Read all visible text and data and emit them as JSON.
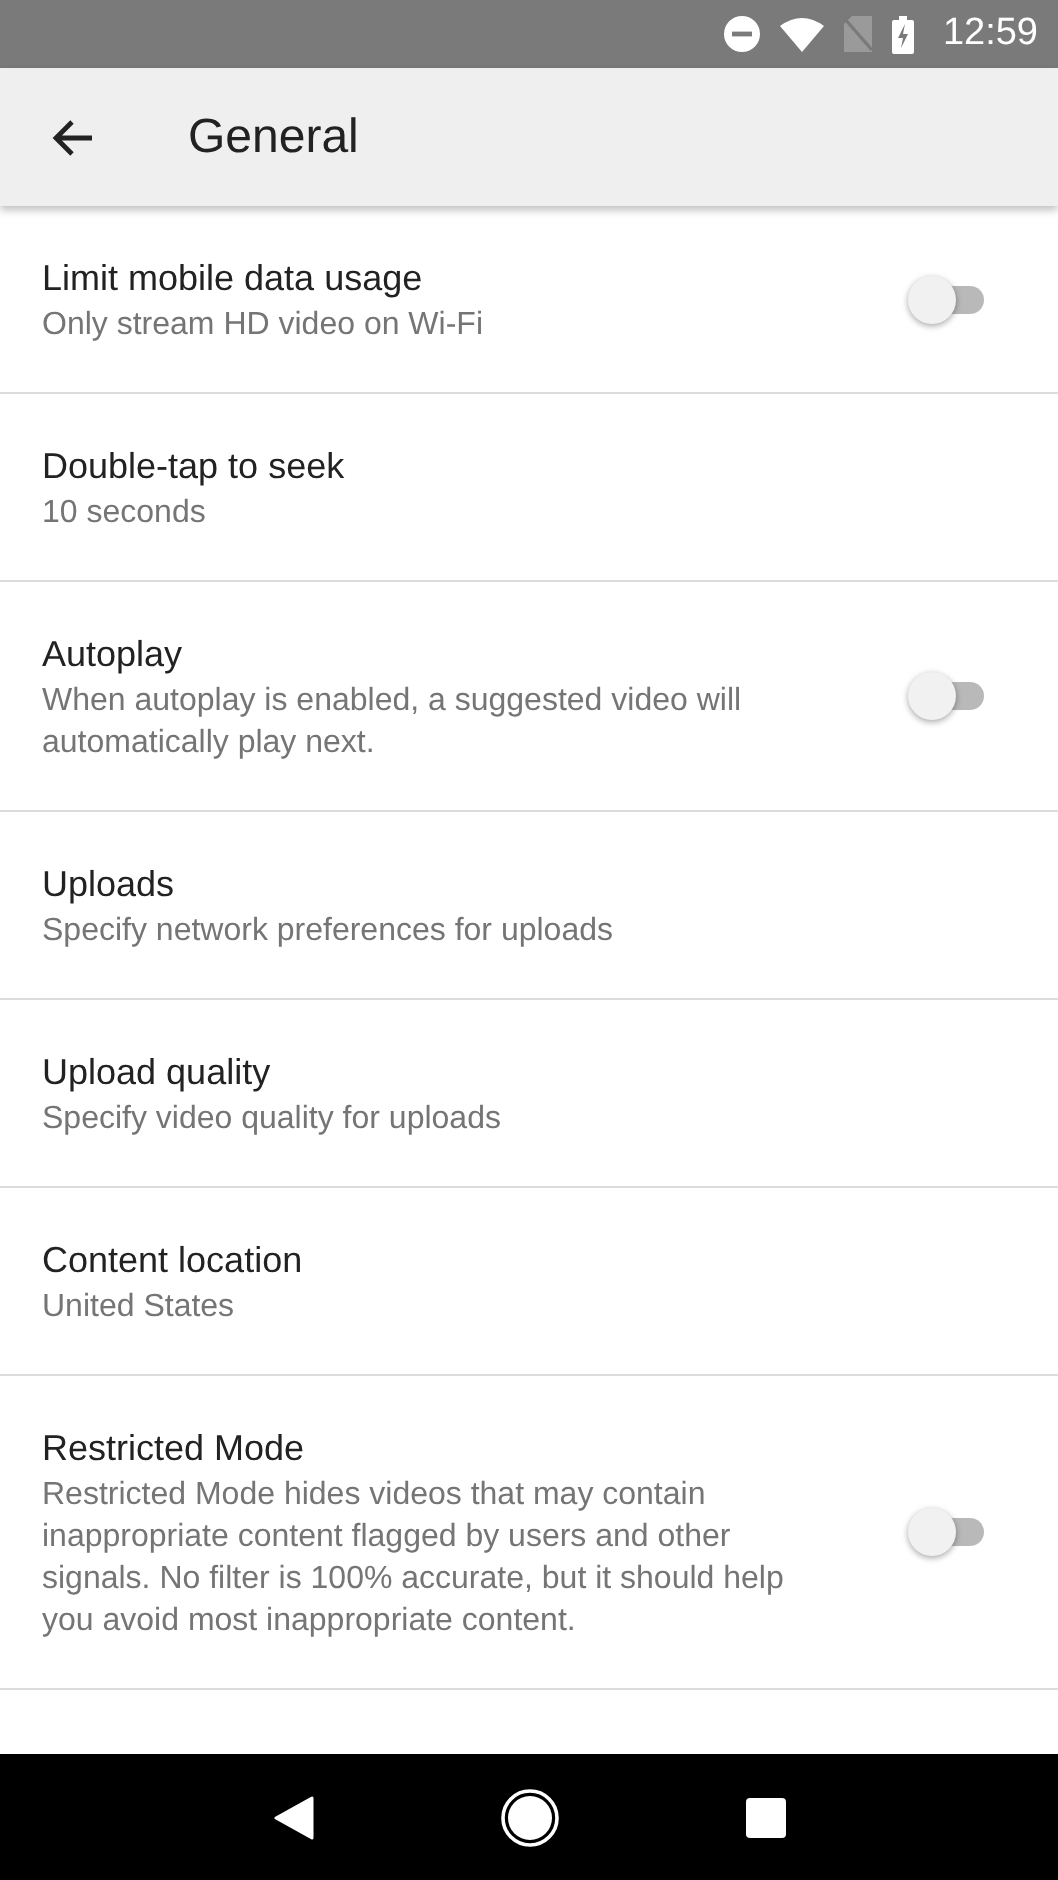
{
  "status_bar": {
    "time": "12:59"
  },
  "app_bar": {
    "title": "General"
  },
  "settings": [
    {
      "kind": "toggle",
      "title": "Limit mobile data usage",
      "subtitle": "Only stream HD video on Wi-Fi",
      "on": false
    },
    {
      "kind": "plain",
      "title": "Double-tap to seek",
      "subtitle": "10 seconds"
    },
    {
      "kind": "toggle",
      "title": "Autoplay",
      "subtitle": "When autoplay is enabled, a suggested video will automatically play next.",
      "on": false
    },
    {
      "kind": "plain",
      "title": "Uploads",
      "subtitle": "Specify network preferences for uploads"
    },
    {
      "kind": "plain",
      "title": "Upload quality",
      "subtitle": "Specify video quality for uploads"
    },
    {
      "kind": "plain",
      "title": "Content location",
      "subtitle": "United States"
    },
    {
      "kind": "toggle",
      "title": "Restricted Mode",
      "subtitle": "Restricted Mode hides videos that may contain inappropriate content flagged by users and other signals. No filter is 100% accurate, but it should help you avoid most inappropriate content.",
      "on": false
    }
  ]
}
